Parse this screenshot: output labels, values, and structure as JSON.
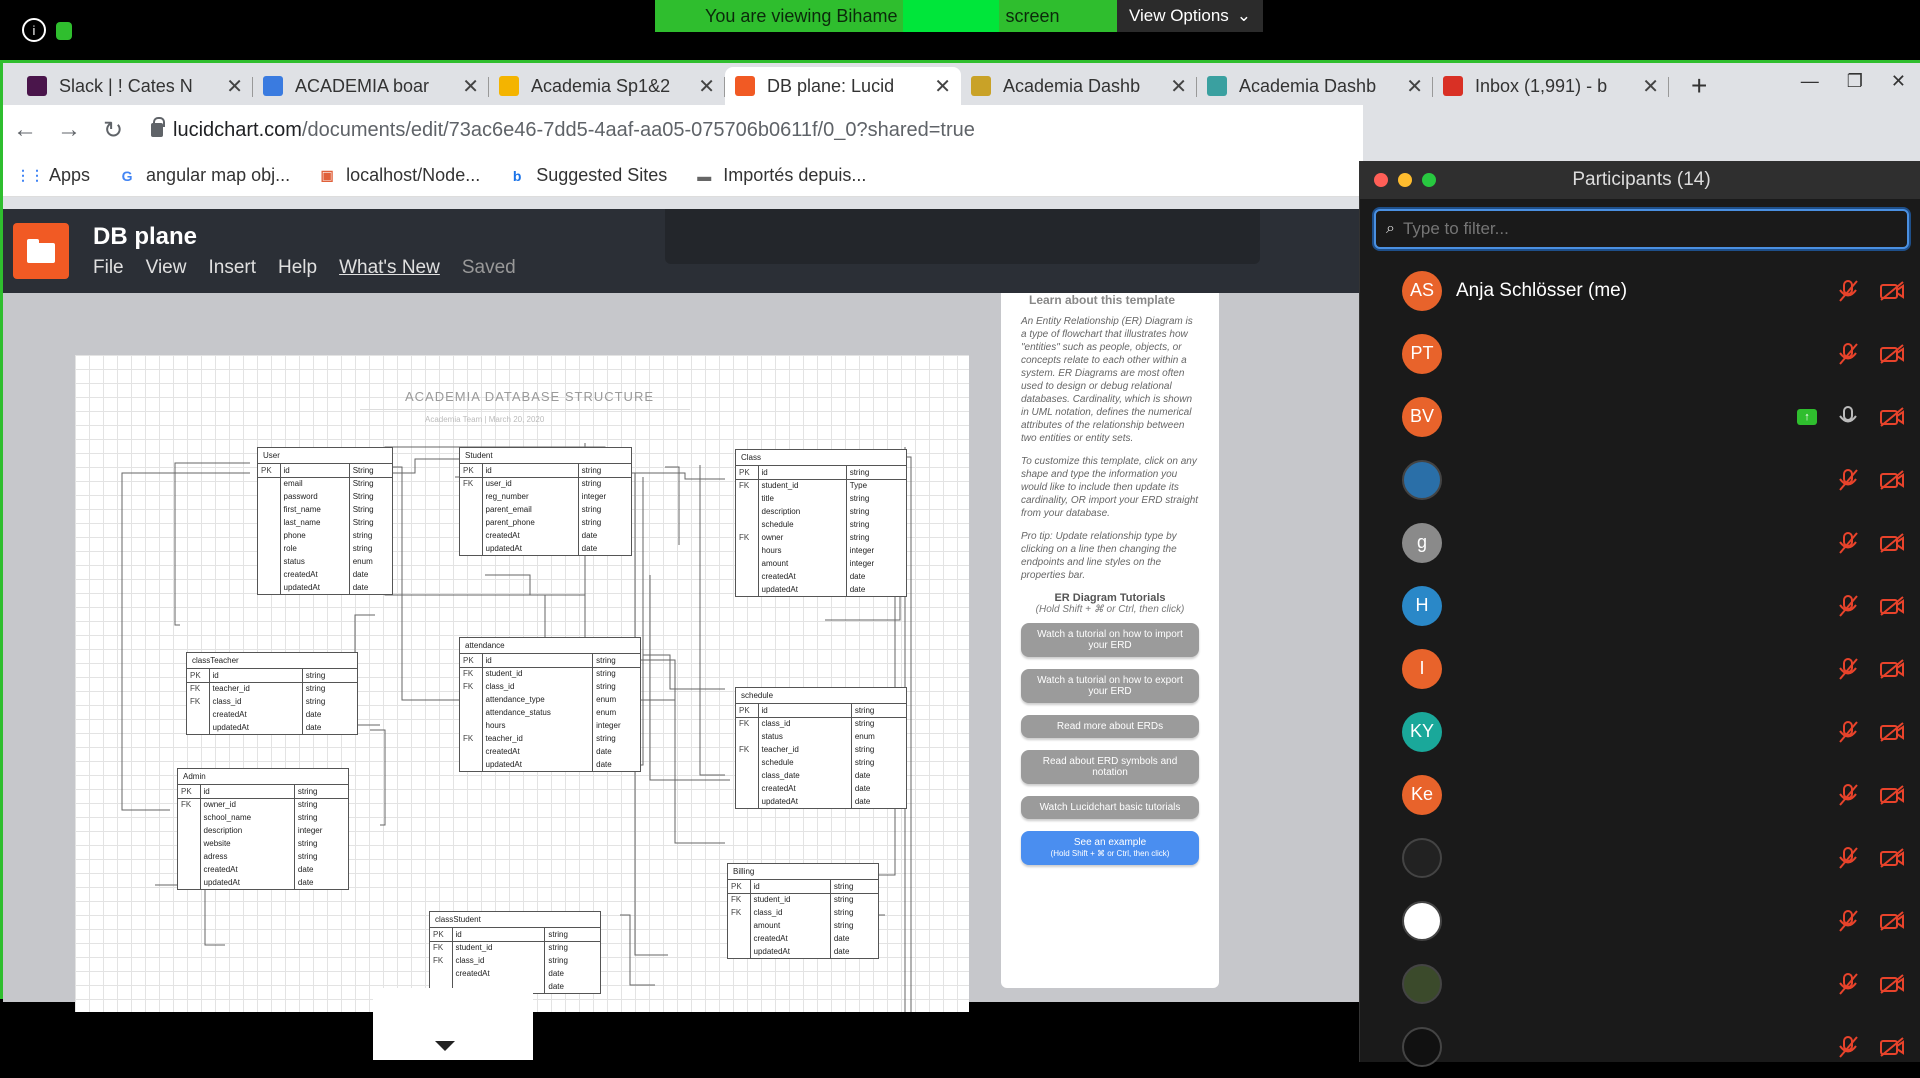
{
  "zoom": {
    "viewing_prefix": "You are viewing Bihame",
    "viewing_suffix": "screen",
    "view_options": "View Options",
    "colors": {
      "banner": "#2fbe2e",
      "highlight": "#00e63a"
    }
  },
  "browser": {
    "tabs": [
      {
        "title": "Slack | ! Cates N",
        "icon": "slack-icon",
        "color": "#4a154b"
      },
      {
        "title": "ACADEMIA boar",
        "icon": "trello-diamond-icon",
        "color": "#3a7be0"
      },
      {
        "title": "Academia Sp1&2",
        "icon": "slides-icon",
        "color": "#f4b400"
      },
      {
        "title": "DB plane: Lucid",
        "icon": "lucidchart-icon",
        "color": "#f15a24"
      },
      {
        "title": "Academia Dashb",
        "icon": "academia-icon",
        "color": "#c9a227"
      },
      {
        "title": "Academia Dashb",
        "icon": "academia-icon",
        "color": "#3aa0a0"
      },
      {
        "title": "Inbox (1,991) - b",
        "icon": "gmail-icon",
        "color": "#d93025"
      }
    ],
    "url_host": "lucidchart.com",
    "url_path": "/documents/edit/73ac6e46-7dd5-4aaf-aa05-075706b0611f/0_0?shared=true",
    "bookmarks": [
      {
        "label": "Apps",
        "icon": "apps-grid-icon"
      },
      {
        "label": "angular map obj...",
        "icon": "google-icon"
      },
      {
        "label": "localhost/Node...",
        "icon": "localhost-icon"
      },
      {
        "label": "Suggested Sites",
        "icon": "bing-icon"
      },
      {
        "label": "Importés depuis...",
        "icon": "folder-icon"
      }
    ]
  },
  "lucid": {
    "doc_title": "DB plane",
    "menu": [
      "File",
      "View",
      "Insert",
      "Help",
      "What's New",
      "Saved"
    ],
    "diagram_title": "ACADEMIA DATABASE STRUCTURE",
    "diagram_subtitle": "Academia Team | March 20, 2020",
    "entities": {
      "user": {
        "name": "User",
        "rows": [
          [
            "PK",
            "id",
            "String"
          ],
          [
            "",
            "email",
            "String"
          ],
          [
            "",
            "password",
            "String"
          ],
          [
            "",
            "first_name",
            "String"
          ],
          [
            "",
            "last_name",
            "String"
          ],
          [
            "",
            "phone",
            "string"
          ],
          [
            "",
            "role",
            "string"
          ],
          [
            "",
            "status",
            "enum"
          ],
          [
            "",
            "createdAt",
            "date"
          ],
          [
            "",
            "updatedAt",
            "date"
          ]
        ]
      },
      "student": {
        "name": "Student",
        "rows": [
          [
            "PK",
            "id",
            "string"
          ],
          [
            "FK",
            "user_id",
            "string"
          ],
          [
            "",
            "reg_number",
            "integer"
          ],
          [
            "",
            "parent_email",
            "string"
          ],
          [
            "",
            "parent_phone",
            "string"
          ],
          [
            "",
            "createdAt",
            "date"
          ],
          [
            "",
            "updatedAt",
            "date"
          ]
        ]
      },
      "class": {
        "name": "Class",
        "rows": [
          [
            "PK",
            "id",
            "string"
          ],
          [
            "FK",
            "student_id",
            "Type"
          ],
          [
            "",
            "title",
            "string"
          ],
          [
            "",
            "description",
            "string"
          ],
          [
            "",
            "schedule",
            "string"
          ],
          [
            "FK",
            "owner",
            "string"
          ],
          [
            "",
            "hours",
            "integer"
          ],
          [
            "",
            "amount",
            "integer"
          ],
          [
            "",
            "createdAt",
            "date"
          ],
          [
            "",
            "updatedAt",
            "date"
          ]
        ]
      },
      "classTeacher": {
        "name": "classTeacher",
        "rows": [
          [
            "PK",
            "id",
            "string"
          ],
          [
            "FK",
            "teacher_id",
            "string"
          ],
          [
            "FK",
            "class_id",
            "string"
          ],
          [
            "",
            "createdAt",
            "date"
          ],
          [
            "",
            "updatedAt",
            "date"
          ]
        ]
      },
      "attendance": {
        "name": "attendance",
        "rows": [
          [
            "PK",
            "id",
            "string"
          ],
          [
            "FK",
            "student_id",
            "string"
          ],
          [
            "FK",
            "class_id",
            "string"
          ],
          [
            "",
            "attendance_type",
            "enum"
          ],
          [
            "",
            "attendance_status",
            "enum"
          ],
          [
            "",
            "hours",
            "integer"
          ],
          [
            "FK",
            "teacher_id",
            "string"
          ],
          [
            "",
            "createdAt",
            "date"
          ],
          [
            "",
            "updatedAt",
            "date"
          ]
        ]
      },
      "schedule": {
        "name": "schedule",
        "rows": [
          [
            "PK",
            "id",
            "string"
          ],
          [
            "FK",
            "class_id",
            "string"
          ],
          [
            "",
            "status",
            "enum"
          ],
          [
            "FK",
            "teacher_id",
            "string"
          ],
          [
            "",
            "schedule",
            "string"
          ],
          [
            "",
            "class_date",
            "date"
          ],
          [
            "",
            "createdAt",
            "date"
          ],
          [
            "",
            "updatedAt",
            "date"
          ]
        ]
      },
      "admin": {
        "name": "Admin",
        "rows": [
          [
            "PK",
            "id",
            "string"
          ],
          [
            "FK",
            "owner_id",
            "string"
          ],
          [
            "",
            "school_name",
            "string"
          ],
          [
            "",
            "description",
            "integer"
          ],
          [
            "",
            "website",
            "string"
          ],
          [
            "",
            "adress",
            "string"
          ],
          [
            "",
            "createdAt",
            "date"
          ],
          [
            "",
            "updatedAt",
            "date"
          ]
        ]
      },
      "billing": {
        "name": "Billing",
        "rows": [
          [
            "PK",
            "id",
            "string"
          ],
          [
            "FK",
            "student_id",
            "string"
          ],
          [
            "FK",
            "class_id",
            "string"
          ],
          [
            "",
            "amount",
            "string"
          ],
          [
            "",
            "createdAt",
            "date"
          ],
          [
            "",
            "updatedAt",
            "date"
          ]
        ]
      },
      "classStudent": {
        "name": "classStudent",
        "rows": [
          [
            "PK",
            "id",
            "string"
          ],
          [
            "FK",
            "student_id",
            "string"
          ],
          [
            "FK",
            "class_id",
            "string"
          ],
          [
            "",
            "createdAt",
            "date"
          ],
          [
            "",
            "",
            "date"
          ]
        ]
      }
    },
    "side": {
      "heading": "Learn about this template",
      "p1": "An Entity Relationship (ER) Diagram is a type of flowchart that illustrates how \"entities\" such as people, objects, or concepts relate to each other within a system. ER Diagrams are most often used to design or debug relational databases. Cardinality, which is shown in UML notation, defines the numerical attributes of the relationship between two entities or entity sets.",
      "p2": "To customize this template, click on any shape and type the information you would like to include then update its cardinality, OR import your ERD straight from your database.",
      "p3": "Pro tip: Update relationship type by clicking on a line then changing the endpoints and line styles on the properties bar.",
      "tut_title": "ER Diagram Tutorials",
      "tut_sub": "(Hold Shift + ⌘ or Ctrl, then click)",
      "buttons": [
        "Watch a tutorial on how to import your ERD",
        "Watch a tutorial on how to export your ERD",
        "Read more about ERDs",
        "Read about ERD symbols and notation",
        "Watch Lucidchart basic tutorials"
      ],
      "example_btn": "See an example",
      "example_sub": "(Hold Shift + ⌘ or Ctrl, then click)"
    }
  },
  "participants": {
    "title": "Participants (14)",
    "search_placeholder": "Type to filter...",
    "list": [
      {
        "initials": "AS",
        "name": "Anja Schlösser (me)",
        "color": "#e8632b",
        "muted": true,
        "sharing": false
      },
      {
        "initials": "PT",
        "name": "",
        "color": "#e8632b",
        "muted": true,
        "sharing": false
      },
      {
        "initials": "BV",
        "name": "",
        "color": "#e8632b",
        "muted": false,
        "sharing": true
      },
      {
        "initials": "",
        "name": "",
        "color": "#2a6fa8",
        "muted": true,
        "sharing": false,
        "photo": true
      },
      {
        "initials": "g",
        "name": "",
        "color": "#8a8a8a",
        "muted": true,
        "sharing": false
      },
      {
        "initials": "H",
        "name": "",
        "color": "#2a88c8",
        "muted": true,
        "sharing": false
      },
      {
        "initials": "I",
        "name": "",
        "color": "#e8632b",
        "muted": true,
        "sharing": false
      },
      {
        "initials": "KY",
        "name": "",
        "color": "#1aa89a",
        "muted": true,
        "sharing": false
      },
      {
        "initials": "Ke",
        "name": "",
        "color": "#e8632b",
        "muted": true,
        "sharing": false
      },
      {
        "initials": "",
        "name": "",
        "color": "#222",
        "muted": true,
        "sharing": false,
        "photo": true
      },
      {
        "initials": "",
        "name": "",
        "color": "#fff",
        "muted": true,
        "sharing": false,
        "photo": true
      },
      {
        "initials": "",
        "name": "",
        "color": "#3b4a2b",
        "muted": true,
        "sharing": false,
        "photo": true
      },
      {
        "initials": "",
        "name": "",
        "color": "#111",
        "muted": true,
        "sharing": false,
        "photo": true
      }
    ]
  }
}
